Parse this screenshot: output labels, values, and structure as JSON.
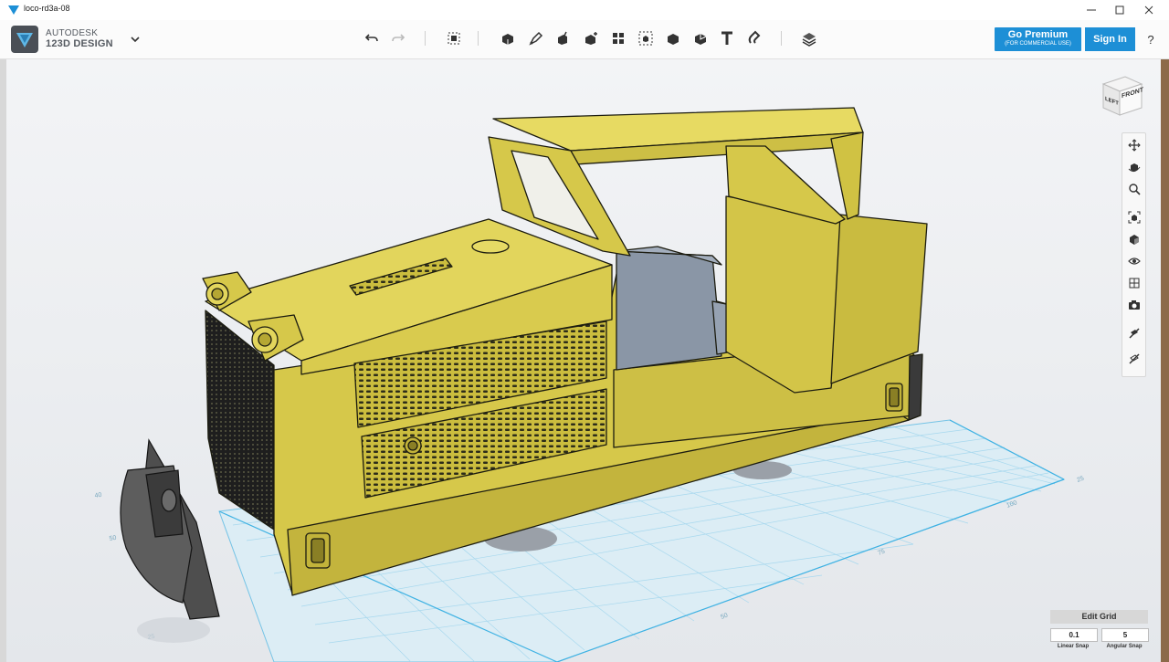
{
  "window": {
    "title": "loco-rd3a-08"
  },
  "app": {
    "brand_line1": "AUTODESK",
    "brand_line2": "123D DESIGN"
  },
  "account": {
    "premium_label": "Go Premium",
    "premium_sub": "(FOR COMMERCIAL USE)",
    "signin_label": "Sign In",
    "help_label": "?"
  },
  "toolbar": {
    "tools": [
      "undo-icon",
      "redo-icon",
      "transform-icon",
      "primitives-icon",
      "sketch-icon",
      "construct-icon",
      "modify-icon",
      "pattern-icon",
      "group-icon",
      "combine-icon",
      "measure-icon",
      "text-icon",
      "snap-icon",
      "material-icon"
    ]
  },
  "viewcube": {
    "face_front": "FRONT",
    "face_left": "LEFT"
  },
  "navbar": {
    "tools": [
      "pan-icon",
      "orbit-icon",
      "zoom-icon",
      "fit-icon",
      "view-mode-icon",
      "visibility-icon",
      "material-view-icon",
      "camera-icon",
      "grid-snap-icon",
      "outline-icon"
    ]
  },
  "grid": {
    "header": "Edit Grid",
    "linear_snap_value": "0.1",
    "angular_snap_value": "5",
    "linear_snap_label": "Linear Snap",
    "angular_snap_label": "Angular Snap",
    "axis_labels": [
      "100",
      "75",
      "50",
      "25",
      "25",
      "50",
      "40"
    ]
  },
  "colors": {
    "accent": "#1d8fd6",
    "model_body": "#d6c84a",
    "model_dark": "#4a4a4a",
    "grid_line": "#8fd0ec",
    "green_part": "#3fbf4a",
    "gray_block": "#8a96a6"
  }
}
